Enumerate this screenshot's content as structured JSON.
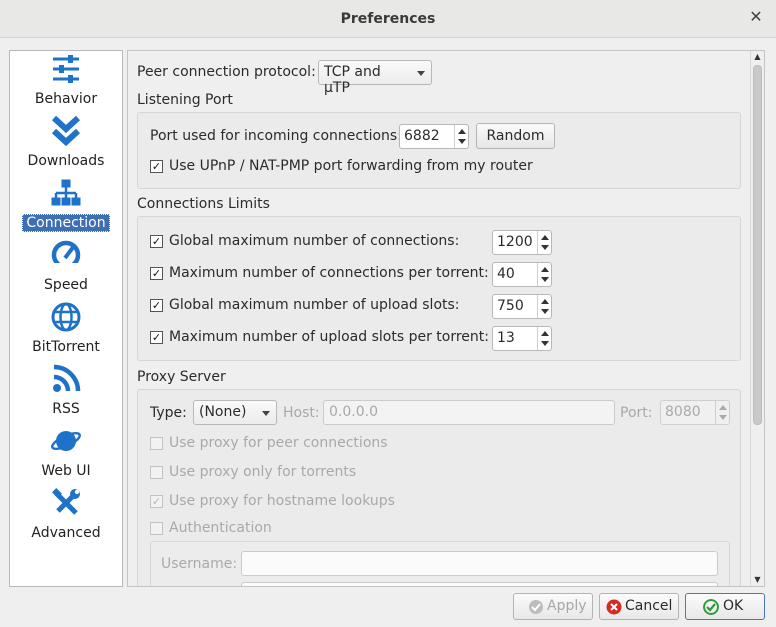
{
  "window": {
    "title": "Preferences"
  },
  "sidebar": {
    "items": [
      {
        "label": "Behavior",
        "icon": "sliders-icon"
      },
      {
        "label": "Downloads",
        "icon": "double-chevron-down-icon"
      },
      {
        "label": "Connection",
        "icon": "network-icon",
        "active": true
      },
      {
        "label": "Speed",
        "icon": "speedometer-icon"
      },
      {
        "label": "BitTorrent",
        "icon": "globe-icon"
      },
      {
        "label": "RSS",
        "icon": "rss-icon"
      },
      {
        "label": "Web UI",
        "icon": "planet-icon"
      },
      {
        "label": "Advanced",
        "icon": "tools-icon"
      }
    ]
  },
  "connection": {
    "protocol_label": "Peer connection protocol:",
    "protocol_value": "TCP and μTP",
    "listening": {
      "heading": "Listening Port",
      "port_label": "Port used for incoming connections:",
      "port_value": "6882",
      "random_button": "Random",
      "upnp_label": "Use UPnP / NAT-PMP port forwarding from my router",
      "upnp_checked": true
    },
    "limits": {
      "heading": "Connections Limits",
      "rows": [
        {
          "label": "Global maximum number of connections:",
          "value": "1200",
          "checked": true
        },
        {
          "label": "Maximum number of connections per torrent:",
          "value": "40",
          "checked": true
        },
        {
          "label": "Global maximum number of upload slots:",
          "value": "750",
          "checked": true
        },
        {
          "label": "Maximum number of upload slots per torrent:",
          "value": "13",
          "checked": true
        }
      ]
    },
    "proxy": {
      "heading": "Proxy Server",
      "type_label": "Type:",
      "type_value": "(None)",
      "host_label": "Host:",
      "host_value": "0.0.0.0",
      "port_label": "Port:",
      "port_value": "8080",
      "options": [
        {
          "label": "Use proxy for peer connections",
          "checked": false
        },
        {
          "label": "Use proxy only for torrents",
          "checked": false
        },
        {
          "label": "Use proxy for hostname lookups",
          "checked": true
        }
      ],
      "auth_label": "Authentication",
      "auth_checked": false,
      "username_label": "Username:",
      "username_value": ""
    }
  },
  "footer": {
    "apply": "Apply",
    "cancel": "Cancel",
    "ok": "OK"
  },
  "colors": {
    "accent": "#3d6fb2",
    "icon_blue": "#1f72c9",
    "cancel_red": "#d52b1e",
    "ok_green": "#2e9b3a"
  }
}
